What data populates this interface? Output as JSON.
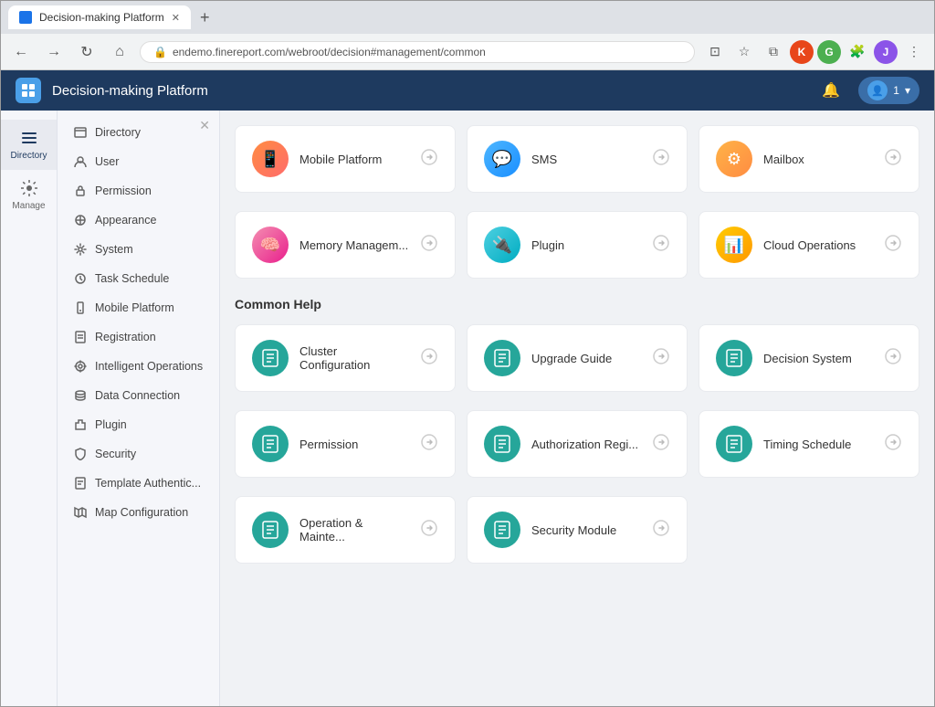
{
  "browser": {
    "tab_title": "Decision-making Platform",
    "new_tab_label": "+",
    "url": "endemo.finereport.com/webroot/decision#management/common",
    "url_protocol": "🔒",
    "back_btn": "←",
    "forward_btn": "→",
    "refresh_btn": "↻",
    "home_btn": "⌂",
    "user_avatar_label": "J"
  },
  "header": {
    "title": "Decision-making Platform",
    "bell_icon": "🔔",
    "user_label": "1",
    "chevron": "▾"
  },
  "icon_nav": [
    {
      "id": "directory",
      "label": "Directory",
      "active": true
    },
    {
      "id": "manage",
      "label": "Manage",
      "active": false
    }
  ],
  "sidebar": {
    "pin_icon": "✕",
    "items": [
      {
        "id": "directory",
        "label": "Directory",
        "icon": "list",
        "active": false
      },
      {
        "id": "user",
        "label": "User",
        "icon": "user",
        "active": false
      },
      {
        "id": "permission",
        "label": "Permission",
        "icon": "lock",
        "active": false
      },
      {
        "id": "appearance",
        "label": "Appearance",
        "icon": "appearance",
        "active": false
      },
      {
        "id": "system",
        "label": "System",
        "icon": "system",
        "active": false
      },
      {
        "id": "task-schedule",
        "label": "Task Schedule",
        "icon": "clock",
        "active": false
      },
      {
        "id": "mobile-platform",
        "label": "Mobile Platform",
        "icon": "mobile",
        "active": false
      },
      {
        "id": "registration",
        "label": "Registration",
        "icon": "reg",
        "active": false
      },
      {
        "id": "intelligent-operations",
        "label": "Intelligent Operations",
        "icon": "gear-cog",
        "active": false
      },
      {
        "id": "data-connection",
        "label": "Data Connection",
        "icon": "data",
        "active": false
      },
      {
        "id": "plugin",
        "label": "Plugin",
        "icon": "plugin",
        "active": false
      },
      {
        "id": "security",
        "label": "Security",
        "icon": "shield",
        "active": false
      },
      {
        "id": "template-authentic",
        "label": "Template Authentic...",
        "icon": "template",
        "active": false
      },
      {
        "id": "map-configuration",
        "label": "Map Configuration",
        "icon": "map",
        "active": false
      }
    ]
  },
  "main": {
    "top_cards": [
      {
        "id": "mobile-platform",
        "label": "Mobile Platform",
        "icon_type": "icon-orange",
        "icon_char": "📱"
      },
      {
        "id": "sms",
        "label": "SMS",
        "icon_type": "icon-blue",
        "icon_char": "💬"
      },
      {
        "id": "mailbox",
        "label": "Mailbox",
        "icon_type": "icon-orange2",
        "icon_char": "⚙"
      }
    ],
    "middle_cards": [
      {
        "id": "memory-management",
        "label": "Memory Managem...",
        "icon_type": "icon-pink",
        "icon_char": "🧠"
      },
      {
        "id": "plugin2",
        "label": "Plugin",
        "icon_type": "icon-teal",
        "icon_char": "🔌"
      },
      {
        "id": "cloud-operations",
        "label": "Cloud Operations",
        "icon_type": "icon-amber",
        "icon_char": "☁"
      }
    ],
    "common_help_title": "Common Help",
    "help_cards_row1": [
      {
        "id": "cluster-configuration",
        "label": "Cluster Configuration",
        "icon_type": "icon-green-doc",
        "icon_char": "📄"
      },
      {
        "id": "upgrade-guide",
        "label": "Upgrade Guide",
        "icon_type": "icon-green-doc",
        "icon_char": "📄"
      },
      {
        "id": "decision-system",
        "label": "Decision System",
        "icon_type": "icon-green-doc",
        "icon_char": "📄"
      }
    ],
    "help_cards_row2": [
      {
        "id": "permission2",
        "label": "Permission",
        "icon_type": "icon-green-doc",
        "icon_char": "📄"
      },
      {
        "id": "authorization-regi",
        "label": "Authorization Regi...",
        "icon_type": "icon-green-doc",
        "icon_char": "📄"
      },
      {
        "id": "timing-schedule",
        "label": "Timing Schedule",
        "icon_type": "icon-green-doc",
        "icon_char": "📄"
      }
    ],
    "help_cards_row3": [
      {
        "id": "operation-mainte",
        "label": "Operation & Mainte...",
        "icon_type": "icon-green-doc",
        "icon_char": "📄"
      },
      {
        "id": "security-module",
        "label": "Security Module",
        "icon_type": "icon-green-doc",
        "icon_char": "📄"
      }
    ],
    "arrow_label": "→"
  }
}
